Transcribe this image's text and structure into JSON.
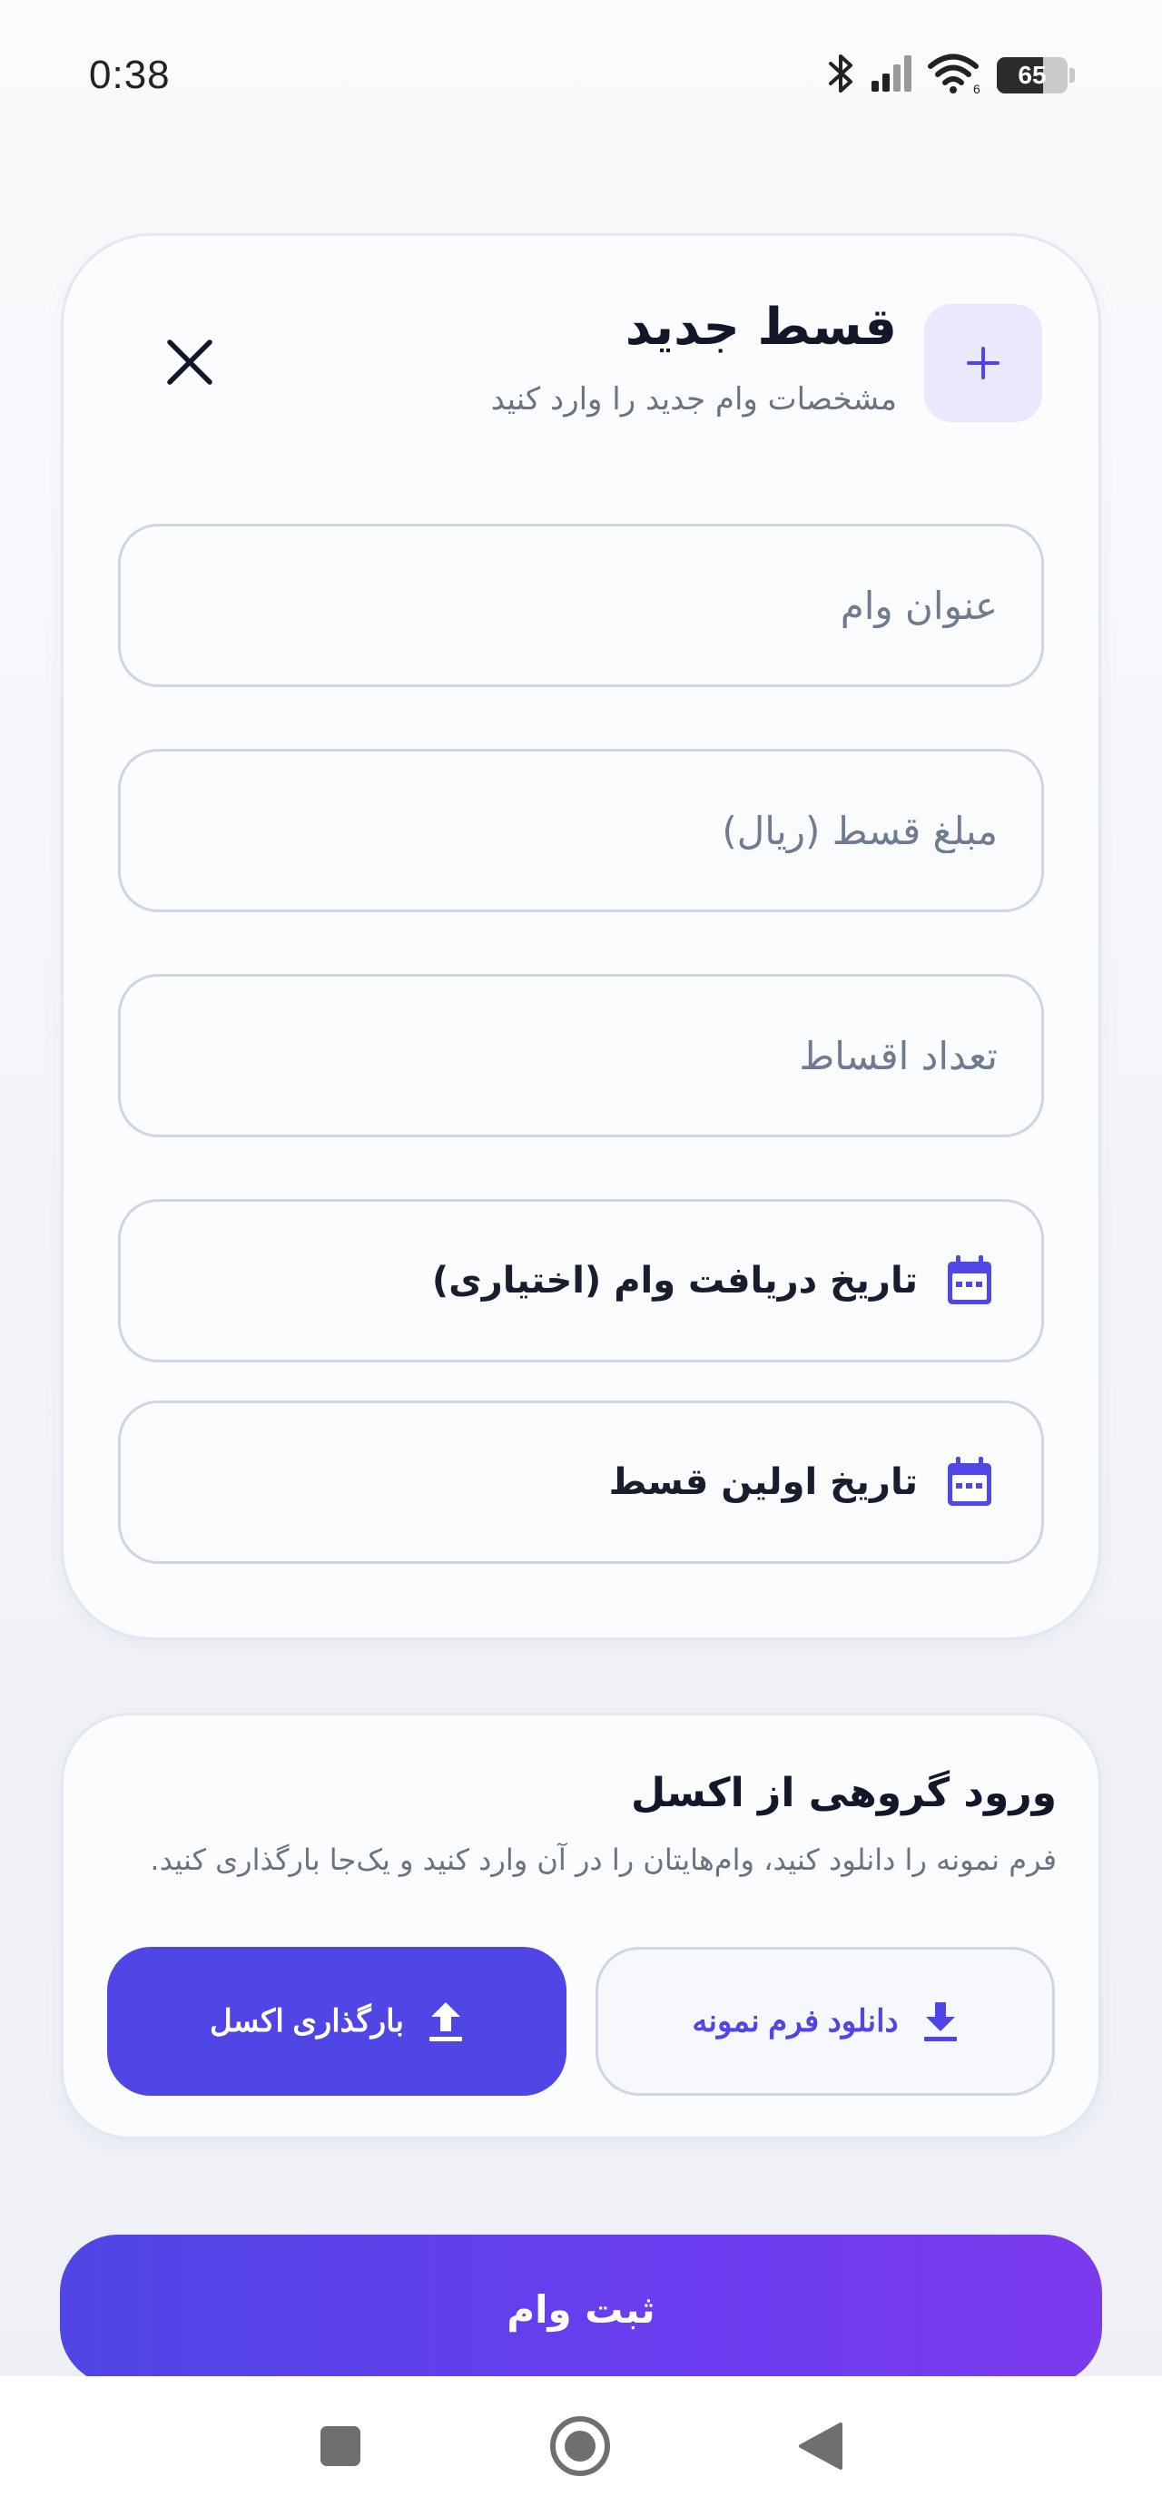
{
  "status_bar": {
    "time": "0:38",
    "battery_level": "65",
    "battery_percent": 65
  },
  "form": {
    "title": "قسط جدید",
    "subtitle": "مشخصات وام جدید را وارد کنید",
    "fields": {
      "loan_title": {
        "placeholder": "عنوان وام",
        "value": ""
      },
      "installment_amount": {
        "placeholder": "مبلغ قسط (ریال)",
        "value": ""
      },
      "installment_count": {
        "placeholder": "تعداد اقساط",
        "value": ""
      }
    },
    "dates": {
      "receive_date_label": "تاریخ دریافت وام (اختیاری)",
      "first_installment_label": "تاریخ اولین قسط"
    }
  },
  "excel_import": {
    "title": "ورود گروهی از اکسل",
    "description": "فرم نمونه را دانلود کنید، وام‌هایتان را در آن وارد کنید و یک‌جا بارگذاری کنید.",
    "download_label": "دانلود فرم نمونه",
    "upload_label": "بارگذاری اکسل"
  },
  "submit_label": "ثبت وام",
  "colors": {
    "accent": "#4f46e5",
    "accent_light": "#ebe7fd",
    "gradient_end": "#7c3aed"
  },
  "icons": {
    "add": "plus-icon",
    "close": "close-icon",
    "date": "calendar-icon",
    "download": "download-icon",
    "upload": "upload-icon"
  }
}
